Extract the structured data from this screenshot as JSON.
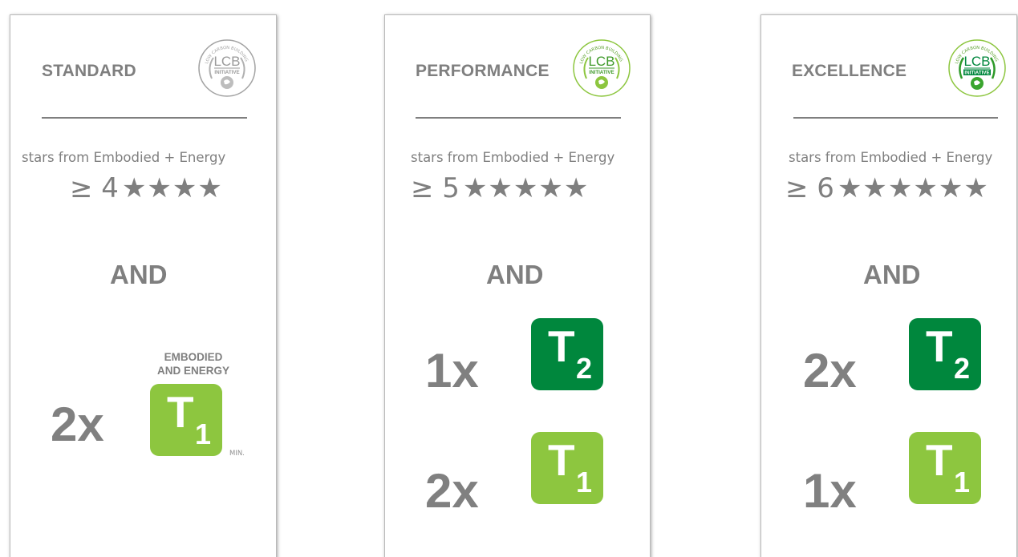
{
  "colors": {
    "text_grey": "#7f7f7f",
    "tier1_green": "#8dc63f",
    "tier2_green": "#00873d",
    "logo_grey": "#9a9a9a",
    "logo_green": "#8dc63f"
  },
  "logo": {
    "wordmark": "LCB",
    "tagline": "INITIATIVE",
    "arc_text": "LOW CARBON BUILDING"
  },
  "cards": [
    {
      "title": "STANDARD",
      "logo_style": "grey",
      "subtitle": "stars from Embodied + Energy",
      "threshold": "≥ 4",
      "stars": "★★★★",
      "connector": "AND",
      "requirements": [
        {
          "multiplier": "2x",
          "tier_letter": "T",
          "tier_number": "1",
          "caption_line1": "EMBODIED",
          "caption_line2": "AND ENERGY",
          "note": "MIN."
        }
      ]
    },
    {
      "title": "PERFORMANCE",
      "logo_style": "green",
      "subtitle": "stars from Embodied + Energy",
      "threshold": "≥ 5",
      "stars": "★★★★★",
      "connector": "AND",
      "requirements": [
        {
          "multiplier": "1x",
          "tier_letter": "T",
          "tier_number": "2"
        },
        {
          "multiplier": "2x",
          "tier_letter": "T",
          "tier_number": "1"
        }
      ]
    },
    {
      "title": "EXCELLENCE",
      "logo_style": "green",
      "subtitle": "stars from Embodied + Energy",
      "threshold": "≥ 6",
      "stars": "★★★★★★",
      "connector": "AND",
      "requirements": [
        {
          "multiplier": "2x",
          "tier_letter": "T",
          "tier_number": "2"
        },
        {
          "multiplier": "1x",
          "tier_letter": "T",
          "tier_number": "1"
        }
      ]
    }
  ]
}
